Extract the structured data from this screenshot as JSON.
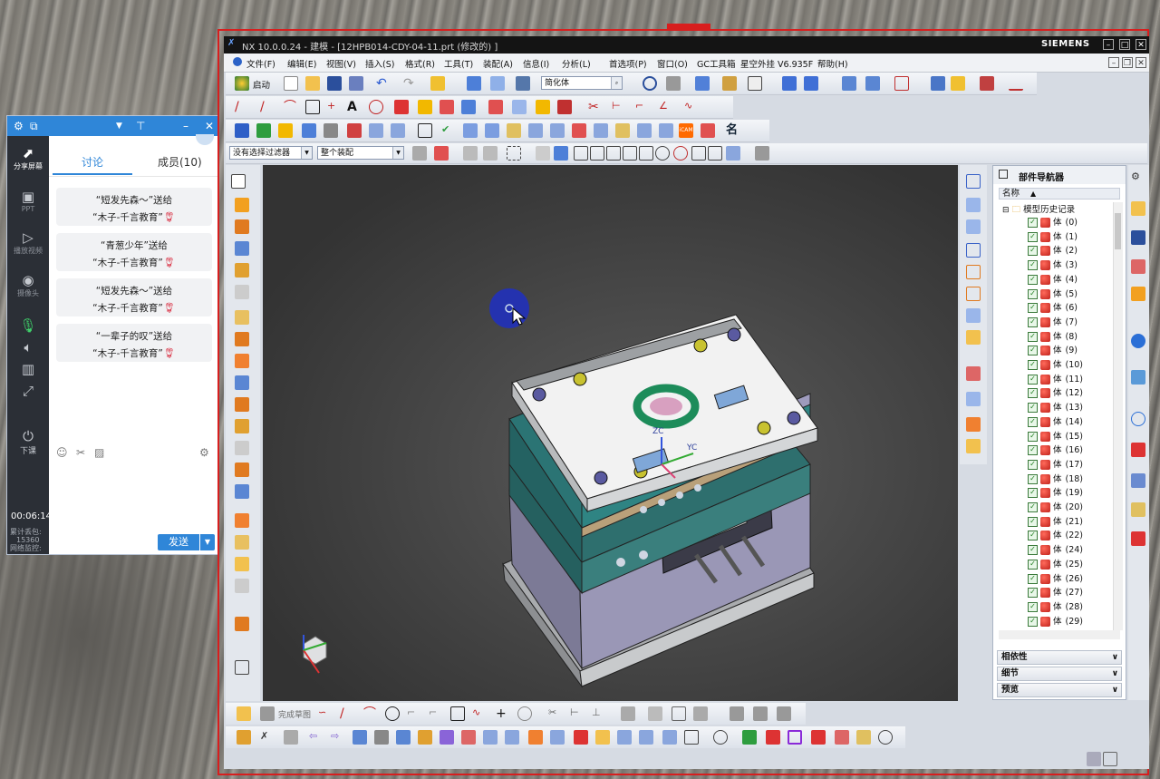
{
  "chat": {
    "side": [
      {
        "name": "share-screen",
        "label": "分享屏幕",
        "icon": "share-screen-icon"
      },
      {
        "name": "ppt",
        "label": "PPT",
        "icon": "ppt-icon"
      },
      {
        "name": "play-video",
        "label": "播放视频",
        "icon": "play-video-icon"
      },
      {
        "name": "camera",
        "label": "摄像头",
        "icon": "camera-icon"
      },
      {
        "name": "end-class",
        "label": "下课",
        "icon": "power-icon"
      }
    ],
    "tabs": {
      "discuss": "讨论",
      "members": "成员(10)"
    },
    "messages": [
      {
        "line1": "“短发先森～”送给",
        "line2": "“木子-千言教育”"
      },
      {
        "line1": "“青葱少年”送给",
        "line2": "“木子-千言教育”"
      },
      {
        "line1": "“短发先森～”送给",
        "line2": "“木子-千言教育”"
      },
      {
        "line1": "“一辈子的叹”送给",
        "line2": "“木子-千言教育”"
      }
    ],
    "send": "发送",
    "timer": "00:06:14",
    "stats": {
      "l1": "累计丢包:",
      "l2": "15360",
      "l3": "网络监控:"
    }
  },
  "nx": {
    "title": "NX 10.0.0.24 - 建模 - [12HPB014-CDY-04-11.prt  (修改的) ]",
    "brand": "SIEMENS",
    "menu": [
      "文件(F)",
      "编辑(E)",
      "视图(V)",
      "插入(S)",
      "格式(R)",
      "工具(T)",
      "装配(A)",
      "信息(I)",
      "分析(L)",
      "首选项(P)",
      "窗口(O)",
      "GC工具箱",
      "星空外挂 V6.935F",
      "帮助(H)"
    ],
    "start_label": "启动",
    "render_style": "简化体",
    "filter": "没有选择过滤器",
    "scope": "整个装配",
    "sketch_label": "完成草图",
    "navigator": {
      "title": "部件导航器",
      "col": "名称",
      "root": "模型历史记录",
      "item_prefix": "体",
      "items": [
        "(0)",
        "(1)",
        "(2)",
        "(3)",
        "(4)",
        "(5)",
        "(6)",
        "(7)",
        "(8)",
        "(9)",
        "(10)",
        "(11)",
        "(12)",
        "(13)",
        "(14)",
        "(15)",
        "(16)",
        "(17)",
        "(18)",
        "(19)",
        "(20)",
        "(21)",
        "(22)",
        "(24)",
        "(25)",
        "(26)",
        "(27)",
        "(28)",
        "(29)"
      ],
      "sections": [
        "相依性",
        "细节",
        "预览"
      ]
    },
    "axes": {
      "zc": "ZC",
      "yc": "YC"
    }
  }
}
